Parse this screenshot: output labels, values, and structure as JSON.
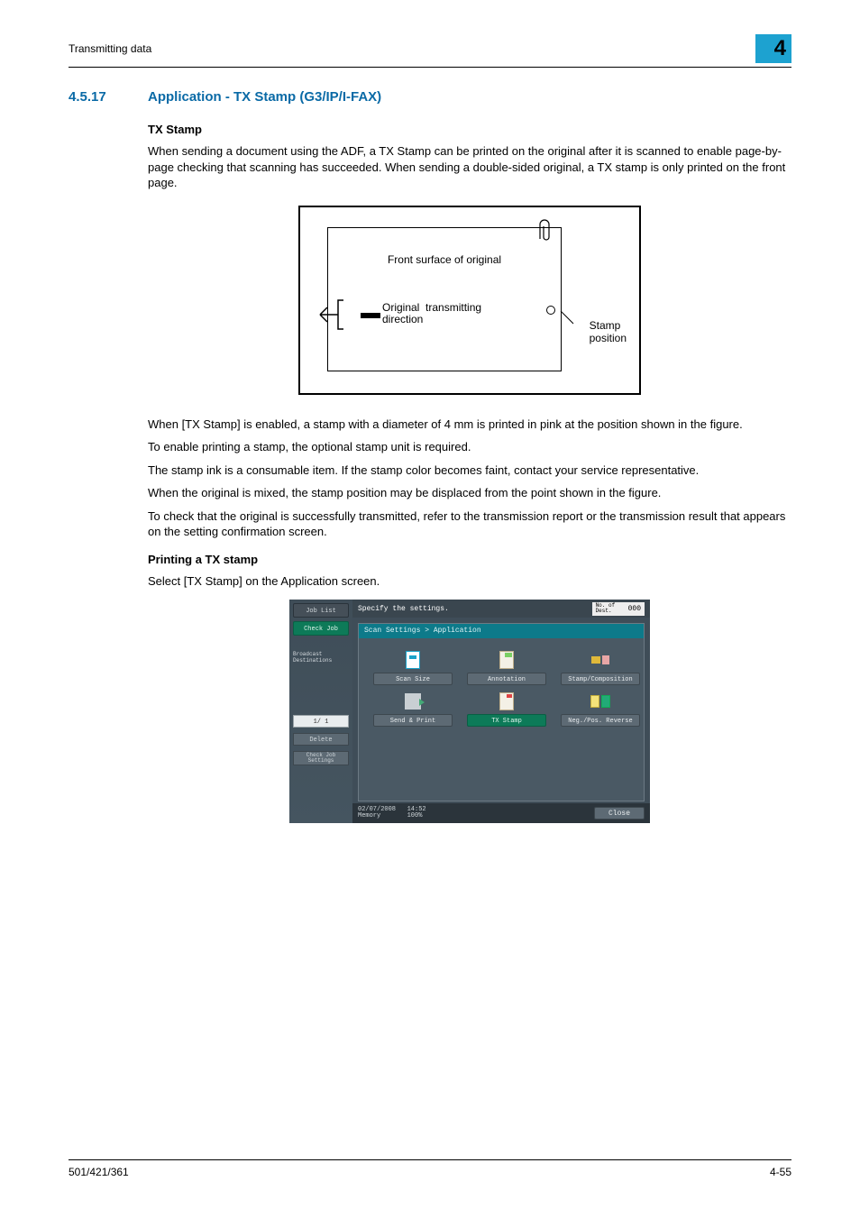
{
  "header": {
    "section": "Transmitting data",
    "chapter": "4"
  },
  "section": {
    "number": "4.5.17",
    "title": "Application - TX Stamp (G3/IP/I-FAX)"
  },
  "h_txstamp": "TX Stamp",
  "p1": "When sending a document using the ADF, a TX Stamp can be printed on the original after it is scanned to enable page-by-page checking that scanning has succeeded. When sending a double-sided original, a TX stamp is only printed on the front page.",
  "fig1": {
    "front": "Front surface of original",
    "dir": "Original  transmitting\ndirection",
    "stamp": "Stamp\nposition"
  },
  "p2": "When [TX Stamp] is enabled, a stamp with a diameter of 4 mm is printed in pink at the position shown in the figure.",
  "p3": "To enable printing a stamp, the optional stamp unit is required.",
  "p4": "The stamp ink is a consumable item. If the stamp color becomes faint, contact your service representative.",
  "p5": "When the original is mixed, the stamp position may be displaced from the point shown in the figure.",
  "p6": "To check that the original is successfully transmitted, refer to the transmission report or the transmission result that appears on the setting confirmation screen.",
  "h_print": "Printing a TX stamp",
  "p7": "Select [TX Stamp] on the Application screen.",
  "panel": {
    "joblist": "Job List",
    "checkjob": "Check Job",
    "broadcast": "Broadcast\nDestinations",
    "page": "1/  1",
    "delete": "Delete",
    "checkjs": "Check Job\nSettings",
    "specify": "Specify the settings.",
    "nodest_l": "No. of\nDest.",
    "nodest_v": "000",
    "crumb": "Scan Settings > Application",
    "btn_scan": "Scan Size",
    "btn_ann": "Annotation",
    "btn_stampc": "Stamp/Composition",
    "btn_send": "Send & Print",
    "btn_tx": "TX Stamp",
    "btn_neg": "Neg./Pos. Reverse",
    "foot_dt": "02/07/2008   14:52\nMemory       100%",
    "close": "Close"
  },
  "footer": {
    "left": "501/421/361",
    "right": "4-55"
  }
}
